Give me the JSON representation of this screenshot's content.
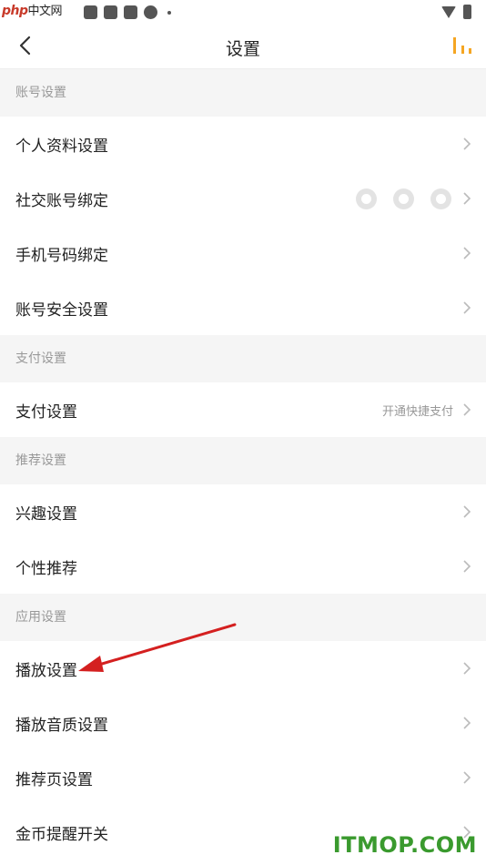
{
  "statusbar": {
    "watermark_brand": "php",
    "watermark_text": "中文网"
  },
  "navbar": {
    "title": "设置"
  },
  "sections": [
    {
      "header": "账号设置",
      "rows": [
        {
          "label": "个人资料设置"
        },
        {
          "label": "社交账号绑定",
          "icons": [
            "wechat-icon",
            "qq-icon",
            "weibo-icon"
          ]
        },
        {
          "label": "手机号码绑定"
        },
        {
          "label": "账号安全设置"
        }
      ]
    },
    {
      "header": "支付设置",
      "rows": [
        {
          "label": "支付设置",
          "value": "开通快捷支付"
        }
      ]
    },
    {
      "header": "推荐设置",
      "rows": [
        {
          "label": "兴趣设置"
        },
        {
          "label": "个性推荐"
        }
      ]
    },
    {
      "header": "应用设置",
      "rows": [
        {
          "label": "播放设置"
        },
        {
          "label": "播放音质设置"
        },
        {
          "label": "推荐页设置"
        },
        {
          "label": "金币提醒开关"
        }
      ]
    }
  ],
  "footer_watermark": "ITMOP.COM",
  "colors": {
    "accent": "#f5a623",
    "annotation_arrow": "#d42020",
    "section_bg": "#f5f5f5"
  }
}
